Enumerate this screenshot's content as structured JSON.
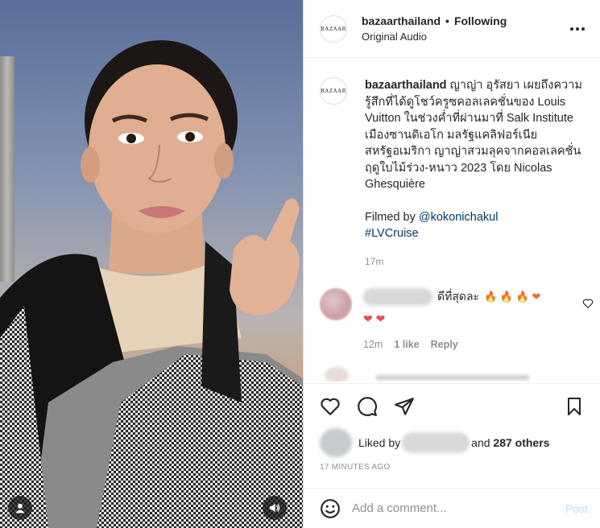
{
  "colors": {
    "link": "#00376b",
    "post_disabled": "#b2dffc",
    "heart": "#ed4956",
    "muted": "#8e8e8e"
  },
  "media": {
    "icons": {
      "user": "user-icon",
      "sound": "speaker-icon"
    }
  },
  "header": {
    "avatar_text": "BAZAAR",
    "username": "bazaarthailand",
    "separator": "•",
    "follow_label": "Following",
    "audio": "Original Audio",
    "more_icon": "more-horizontal-icon"
  },
  "caption": {
    "avatar_text": "BAZAAR",
    "username": "bazaarthailand",
    "text": "ญาญ่า อุรัสยา เผยถึงความรู้สึกที่ได้ดูโชว์ครูซคอลเลคชั่นของ Louis Vuitton ในช่วงค่ำที่ผ่านมาที่ Salk Institute เมืองซานดิเอโก มลรัฐแคลิฟอร์เนีย สหรัฐอเมริกา ญาญ่าสวมลุคจากคอลเลคชั่นฤดูใบไม้ร่วง-หนาว 2023 โดย Nicolas Ghesquière",
    "filmed_by_prefix": "Filmed by ",
    "filmed_by_handle": "@kokonichakul",
    "hashtag": "#LVCruise",
    "time": "17m"
  },
  "comment": {
    "text": "ดีที่สุดละ",
    "emojis": "🔥 🔥 🔥 ❤",
    "emojis2": "❤ ❤",
    "time": "12m",
    "likes": "1 like",
    "reply": "Reply",
    "like_icon": "heart-outline-icon"
  },
  "actions": {
    "like_icon": "heart-outline-icon",
    "comment_icon": "comment-icon",
    "share_icon": "send-icon",
    "save_icon": "bookmark-icon"
  },
  "likes": {
    "prefix": "Liked by",
    "middle": "and",
    "others": "287 others"
  },
  "timestamp": "17 MINUTES AGO",
  "add_comment": {
    "emoji_icon": "smiley-icon",
    "placeholder": "Add a comment...",
    "post_label": "Post"
  }
}
